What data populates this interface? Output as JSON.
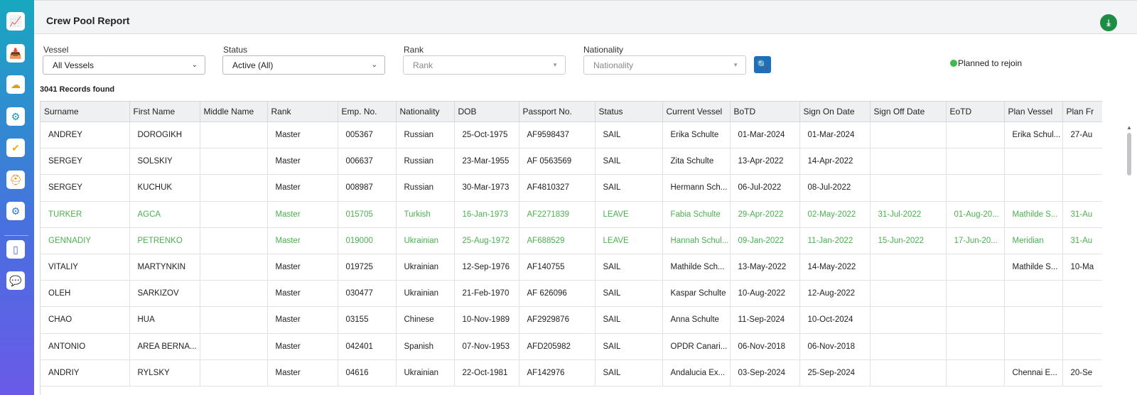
{
  "sidebar": {
    "items": [
      {
        "name": "monitor-icon",
        "glyph": "📈",
        "color": "#1aa5b5"
      },
      {
        "name": "download-tray-icon",
        "glyph": "📥",
        "color": "#3b6fd8"
      },
      {
        "name": "cloud-icon",
        "glyph": "☁",
        "color": "#e59a1a"
      },
      {
        "name": "gear-icon",
        "glyph": "⚙",
        "color": "#1a8fb5"
      },
      {
        "name": "checklist-icon",
        "glyph": "✔",
        "color": "#e5b31a"
      },
      {
        "name": "helmet-icon",
        "glyph": "⛑",
        "color": "#e58a1a"
      },
      {
        "name": "settings-cog-icon",
        "glyph": "⚙",
        "color": "#2e7bd8"
      },
      {
        "name": "mobile-icon",
        "glyph": "▯",
        "color": "#4a63d0"
      },
      {
        "name": "chat-icon",
        "glyph": "💬",
        "color": "#e57e1a"
      }
    ]
  },
  "header": {
    "title": "Crew Pool Report",
    "export_icon": "excel-export-icon",
    "export_glyph": "⤓"
  },
  "filters": {
    "vessel": {
      "label": "Vessel",
      "value": "All Vessels"
    },
    "status": {
      "label": "Status",
      "value": "Active (All)"
    },
    "rank": {
      "label": "Rank",
      "placeholder": "Rank"
    },
    "nationality": {
      "label": "Nationality",
      "placeholder": "Nationality"
    },
    "search_glyph": "🔍"
  },
  "legend": {
    "label": "Planned to rejoin",
    "color": "#3dbb4b"
  },
  "records_text": "3041 Records found",
  "table": {
    "columns": [
      "Surname",
      "First Name",
      "Middle Name",
      "Rank",
      "Emp. No.",
      "Nationality",
      "DOB",
      "Passport No.",
      "Status",
      "Current Vessel",
      "BoTD",
      "Sign On Date",
      "Sign Off Date",
      "EoTD",
      "Plan Vessel",
      "Plan Fr"
    ],
    "rows": [
      {
        "green": false,
        "cells": [
          "ANDREY",
          "DOROGIKH",
          "",
          "Master",
          "005367",
          "Russian",
          "25-Oct-1975",
          "AF9598437",
          "SAIL",
          "Erika Schulte",
          "01-Mar-2024",
          "01-Mar-2024",
          "",
          "",
          "Erika Schul...",
          "27-Au"
        ]
      },
      {
        "green": false,
        "cells": [
          "SERGEY",
          "SOLSKIY",
          "",
          "Master",
          "006637",
          "Russian",
          "23-Mar-1955",
          "AF 0563569",
          "SAIL",
          "Zita Schulte",
          "13-Apr-2022",
          "14-Apr-2022",
          "",
          "",
          "",
          ""
        ]
      },
      {
        "green": false,
        "cells": [
          "SERGEY",
          "KUCHUK",
          "",
          "Master",
          "008987",
          "Russian",
          "30-Mar-1973",
          "AF4810327",
          "SAIL",
          "Hermann Sch...",
          "06-Jul-2022",
          "08-Jul-2022",
          "",
          "",
          "",
          ""
        ]
      },
      {
        "green": true,
        "cells": [
          "TURKER",
          "AGCA",
          "",
          "Master",
          "015705",
          "Turkish",
          "16-Jan-1973",
          "AF2271839",
          "LEAVE",
          "Fabia Schulte",
          "29-Apr-2022",
          "02-May-2022",
          "31-Jul-2022",
          "01-Aug-20...",
          "Mathilde S...",
          "31-Au"
        ]
      },
      {
        "green": true,
        "cells": [
          "GENNADIY",
          "PETRENKO",
          "",
          "Master",
          "019000",
          "Ukrainian",
          "25-Aug-1972",
          "AF688529",
          "LEAVE",
          "Hannah Schul...",
          "09-Jan-2022",
          "11-Jan-2022",
          "15-Jun-2022",
          "17-Jun-20...",
          "Meridian",
          "31-Au"
        ]
      },
      {
        "green": false,
        "cells": [
          "VITALIY",
          "MARTYNKIN",
          "",
          "Master",
          "019725",
          "Ukrainian",
          "12-Sep-1976",
          "AF140755",
          "SAIL",
          "Mathilde Sch...",
          "13-May-2022",
          "14-May-2022",
          "",
          "",
          "Mathilde S...",
          "10-Ma"
        ]
      },
      {
        "green": false,
        "cells": [
          "OLEH",
          "SARKIZOV",
          "",
          "Master",
          "030477",
          "Ukrainian",
          "21-Feb-1970",
          "AF 626096",
          "SAIL",
          "Kaspar Schulte",
          "10-Aug-2022",
          "12-Aug-2022",
          "",
          "",
          "",
          ""
        ]
      },
      {
        "green": false,
        "cells": [
          "CHAO",
          "HUA",
          "",
          "Master",
          "03155",
          "Chinese",
          "10-Nov-1989",
          "AF2929876",
          "SAIL",
          "Anna Schulte",
          "11-Sep-2024",
          "10-Oct-2024",
          "",
          "",
          "",
          ""
        ]
      },
      {
        "green": false,
        "cells": [
          "ANTONIO",
          "AREA BERNA...",
          "",
          "Master",
          "042401",
          "Spanish",
          "07-Nov-1953",
          "AFD205982",
          "SAIL",
          "OPDR Canari...",
          "06-Nov-2018",
          "06-Nov-2018",
          "",
          "",
          "",
          ""
        ]
      },
      {
        "green": false,
        "cells": [
          "ANDRIY",
          "RYLSKY",
          "",
          "Master",
          "04616",
          "Ukrainian",
          "22-Oct-1981",
          "AF142976",
          "SAIL",
          "Andalucia Ex...",
          "03-Sep-2024",
          "25-Sep-2024",
          "",
          "",
          "Chennai E...",
          "20-Se"
        ]
      }
    ]
  }
}
